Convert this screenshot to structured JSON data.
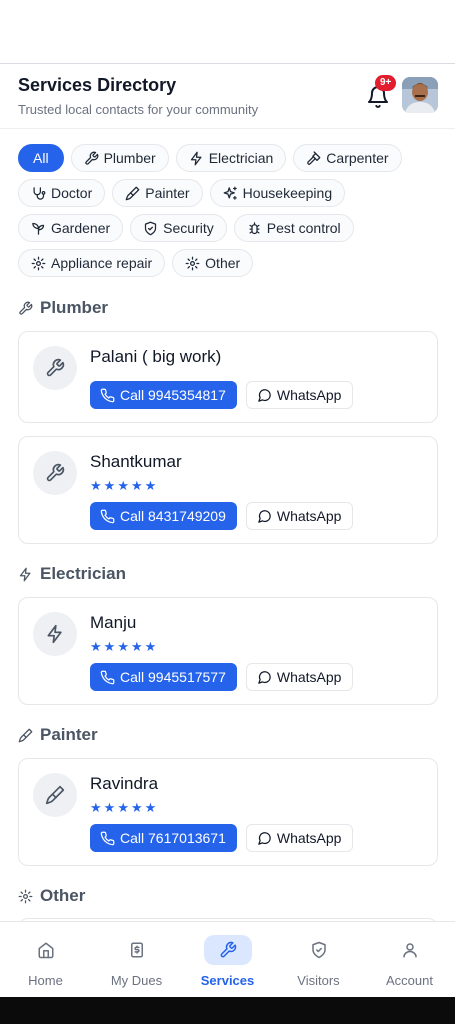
{
  "header": {
    "title": "Services Directory",
    "subtitle": "Trusted local contacts for your community",
    "notification_badge": "9+"
  },
  "filters": [
    {
      "label": "All",
      "icon": "none",
      "active": true
    },
    {
      "label": "Plumber",
      "icon": "wrench-icon"
    },
    {
      "label": "Electrician",
      "icon": "zap-icon"
    },
    {
      "label": "Carpenter",
      "icon": "hammer-icon"
    },
    {
      "label": "Doctor",
      "icon": "stethoscope-icon"
    },
    {
      "label": "Painter",
      "icon": "paintbrush-icon"
    },
    {
      "label": "Housekeeping",
      "icon": "sparkles-icon"
    },
    {
      "label": "Gardener",
      "icon": "sprout-icon"
    },
    {
      "label": "Security",
      "icon": "shield-icon"
    },
    {
      "label": "Pest control",
      "icon": "bug-icon"
    },
    {
      "label": "Appliance repair",
      "icon": "gear-icon"
    },
    {
      "label": "Other",
      "icon": "gear-icon"
    }
  ],
  "sections": [
    {
      "title": "Plumber",
      "icon": "wrench-icon",
      "contacts": [
        {
          "name": "Palani ( big work)",
          "rating": null,
          "call_label": "Call 9945354817",
          "whatsapp_label": "WhatsApp"
        },
        {
          "name": "Shantkumar",
          "rating": 5,
          "call_label": "Call 8431749209",
          "whatsapp_label": "WhatsApp"
        }
      ]
    },
    {
      "title": "Electrician",
      "icon": "zap-icon",
      "contacts": [
        {
          "name": "Manju",
          "rating": 5,
          "call_label": "Call 9945517577",
          "whatsapp_label": "WhatsApp"
        }
      ]
    },
    {
      "title": "Painter",
      "icon": "paintbrush-icon",
      "contacts": [
        {
          "name": "Ravindra",
          "rating": 5,
          "call_label": "Call 7617013671",
          "whatsapp_label": "WhatsApp"
        }
      ]
    },
    {
      "title": "Other",
      "icon": "gear-icon",
      "contacts": []
    }
  ],
  "bottom_nav": [
    {
      "label": "Home",
      "icon": "home-icon"
    },
    {
      "label": "My Dues",
      "icon": "bill-icon"
    },
    {
      "label": "Services",
      "icon": "wrench-icon",
      "active": true
    },
    {
      "label": "Visitors",
      "icon": "shield-check-icon"
    },
    {
      "label": "Account",
      "icon": "user-icon"
    }
  ],
  "colors": {
    "accent": "#2563eb",
    "badge": "#e11d2e",
    "star": "#2563eb"
  }
}
